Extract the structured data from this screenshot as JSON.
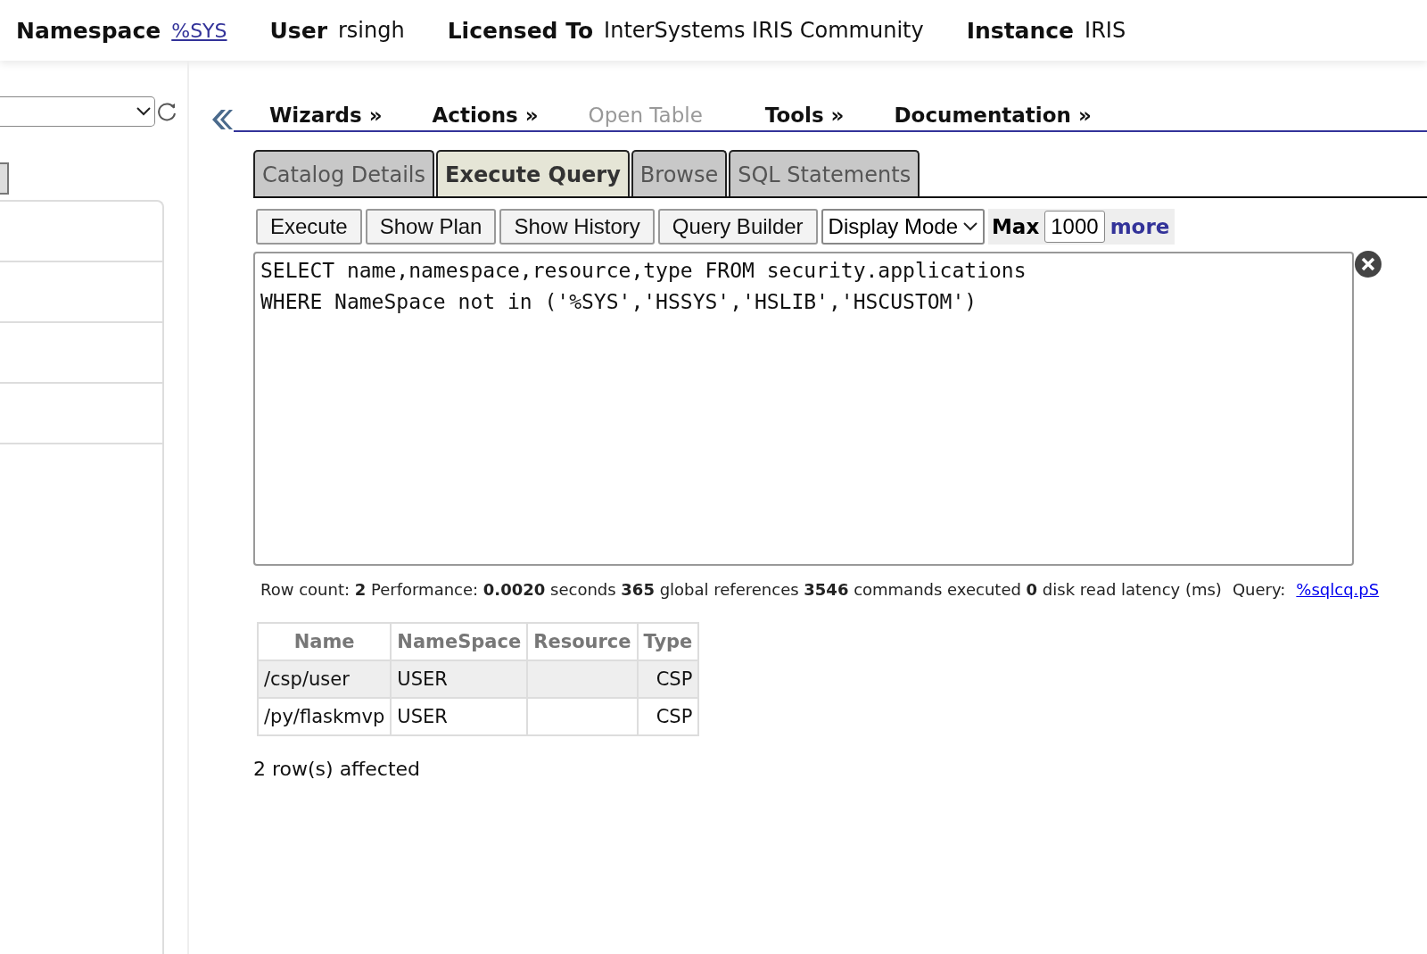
{
  "header": {
    "fields": [
      {
        "label": "Namespace",
        "value": "%SYS",
        "kind": "link"
      },
      {
        "label": "User",
        "value": "rsingh",
        "kind": "text"
      },
      {
        "label": "Licensed To",
        "value": "InterSystems IRIS Community",
        "kind": "text"
      },
      {
        "label": "Instance",
        "value": "IRIS",
        "kind": "text"
      }
    ]
  },
  "menu": [
    {
      "label": "Wizards »",
      "disabled": false
    },
    {
      "label": "Actions »",
      "disabled": false
    },
    {
      "label": "Open Table",
      "disabled": true
    },
    {
      "label": "Tools »",
      "disabled": false
    },
    {
      "label": "Documentation »",
      "disabled": false
    }
  ],
  "tabs": [
    {
      "label": "Catalog Details",
      "selected": false
    },
    {
      "label": "Execute Query",
      "selected": true
    },
    {
      "label": "Browse",
      "selected": false
    },
    {
      "label": "SQL Statements",
      "selected": false
    }
  ],
  "toolbar": {
    "buttons": [
      "Execute",
      "Show Plan",
      "Show History",
      "Query Builder"
    ],
    "display_mode": "Display Mode",
    "max_label": "Max",
    "max_value": "1000",
    "more": "more"
  },
  "query": "SELECT name,namespace,resource,type FROM security.applications\nWHERE NameSpace not in ('%SYS','HSSYS','HSLIB','HSCUSTOM')",
  "stats": {
    "text": "Row count: **2** Performance: **0.0020** seconds  **365** global references **3546** commands executed **0** disk read latency (ms)",
    "query_label": "Query:",
    "query_link": "%sqlcq.pS"
  },
  "table": {
    "columns": [
      "Name",
      "NameSpace",
      "Resource",
      "Type"
    ],
    "rows": [
      [
        "/csp/user",
        "USER",
        "",
        "CSP"
      ],
      [
        "/py/flaskmvp",
        "USER",
        "",
        "CSP"
      ]
    ]
  },
  "result": "2 row(s) affected"
}
